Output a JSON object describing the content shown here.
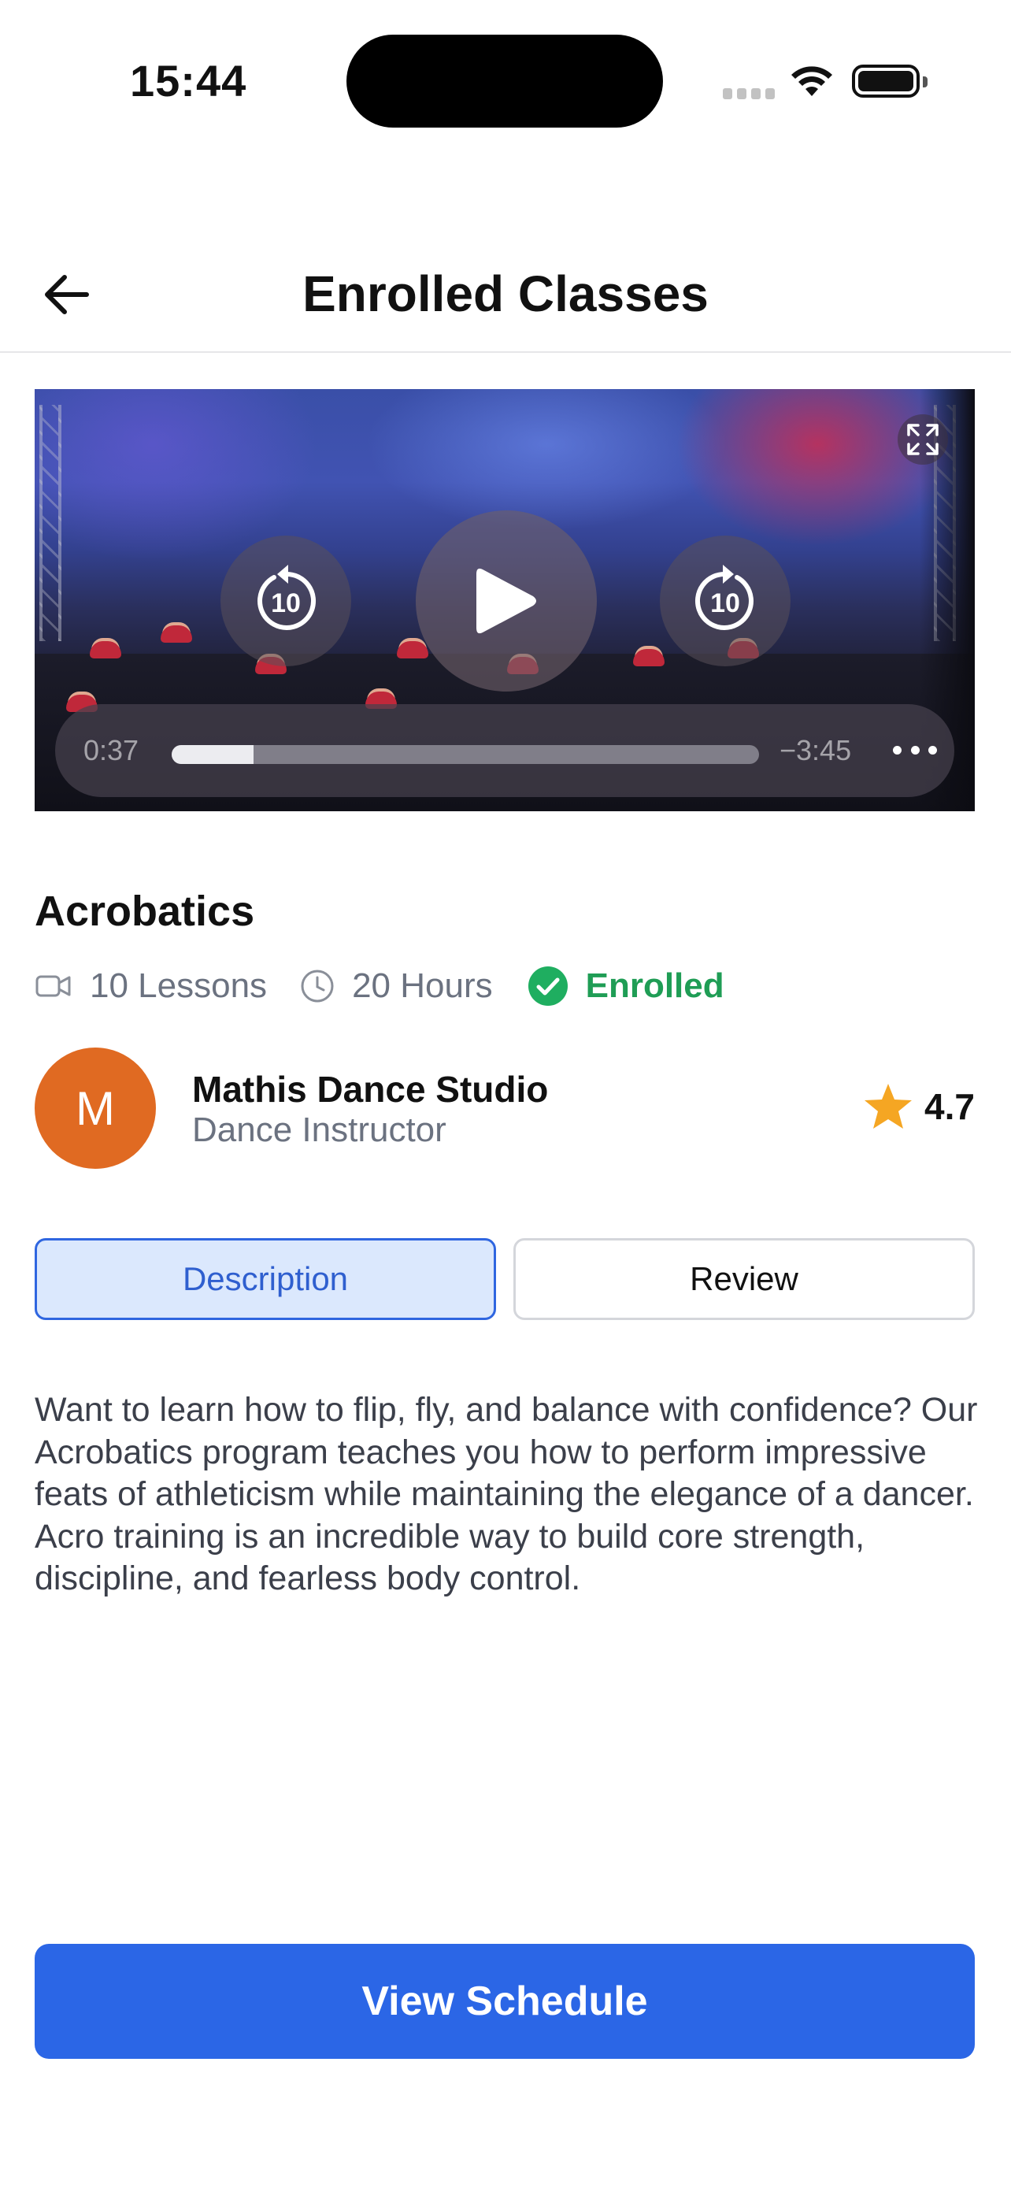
{
  "status_bar": {
    "time": "15:44"
  },
  "header": {
    "title": "Enrolled Classes",
    "back_icon": "arrow-left-icon"
  },
  "video_player": {
    "time_elapsed": "0:37",
    "time_remaining": "−3:45",
    "progress": 0.14,
    "skip_back_seconds": "10",
    "skip_forward_seconds": "10",
    "icons": {
      "fullscreen": "expand-icon",
      "play": "play-icon",
      "skip_back": "rewind-10-icon",
      "skip_forward": "forward-10-icon",
      "more": "ellipsis-icon"
    }
  },
  "course": {
    "title": "Acrobatics",
    "lessons": "10 Lessons",
    "hours": "20 Hours",
    "status": "Enrolled",
    "icons": {
      "lessons": "video-camera-icon",
      "hours": "clock-icon",
      "status": "check-circle-icon"
    }
  },
  "instructor": {
    "avatar_initial": "M",
    "name": "Mathis Dance Studio",
    "role": "Dance Instructor",
    "rating": "4.7",
    "avatar_color": "#e06a22",
    "star_color": "#f5a623"
  },
  "tabs": {
    "description": "Description",
    "review": "Review",
    "active": "description"
  },
  "description": "Want to learn how to flip, fly, and balance with confidence? Our Acrobatics program teaches you how to perform impressive feats of athleticism while maintaining the elegance of a dancer. Acro training is an incredible way to build core strength, discipline, and fearless body control.",
  "cta": {
    "label": "View Schedule",
    "color": "#2b66e6"
  },
  "colors": {
    "accent": "#2b66e6",
    "enrolled": "#1f9d55",
    "muted_text": "#6b7280"
  }
}
